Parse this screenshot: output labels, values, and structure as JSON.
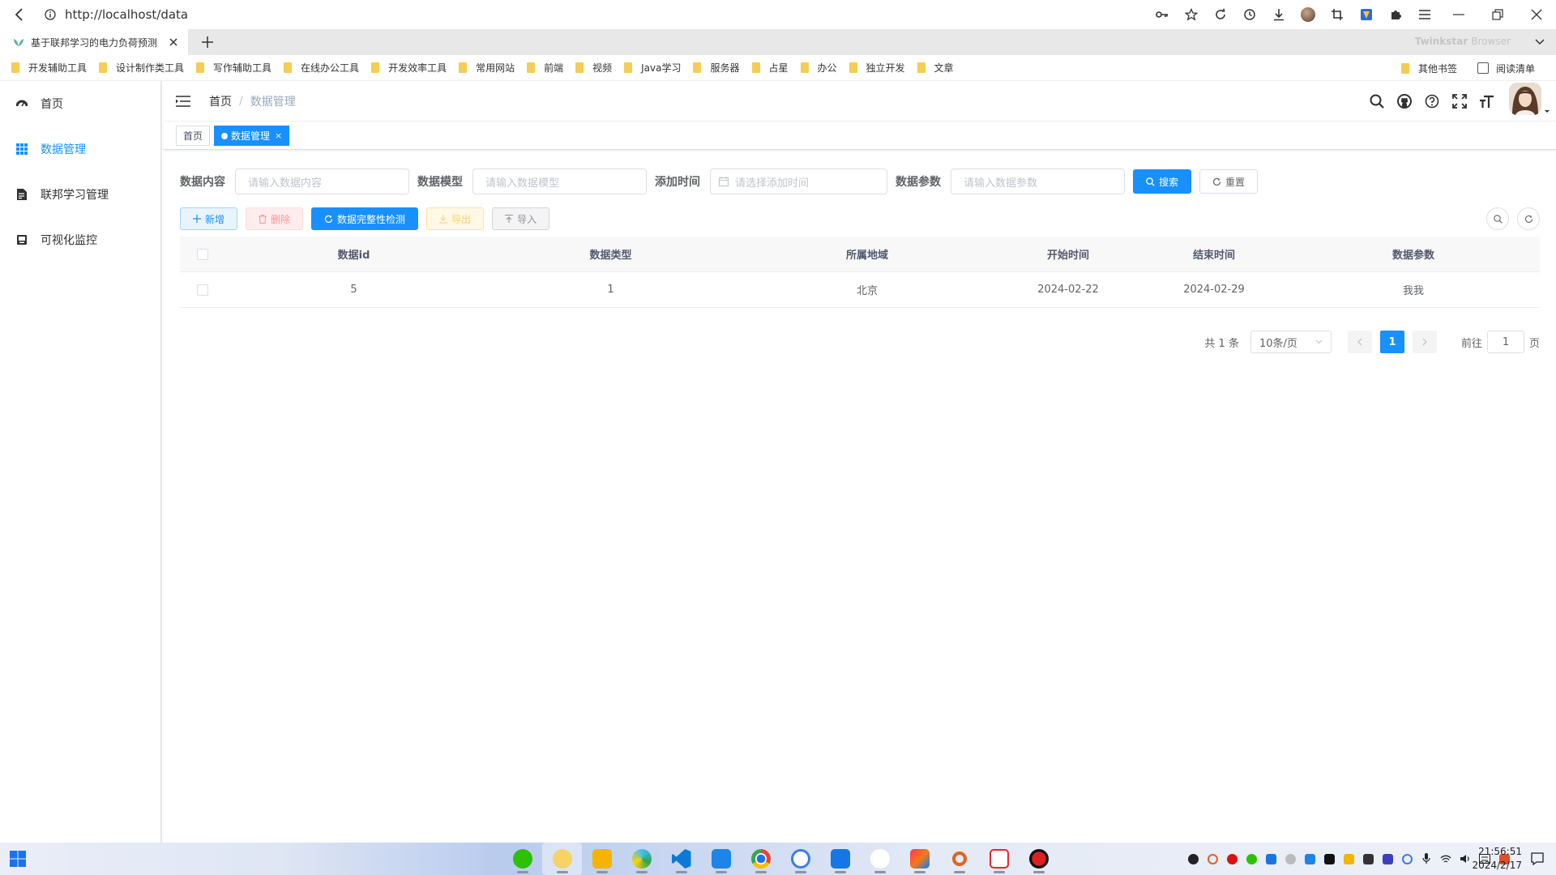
{
  "browser": {
    "url": "http://localhost/data",
    "tab_title": "基于联邦学习的电力负荷预测",
    "brand_name": "Twinkstar",
    "brand_suffix": "Browser",
    "bookmarks": [
      "开发辅助工具",
      "设计制作类工具",
      "写作辅助工具",
      "在线办公工具",
      "开发效率工具",
      "常用网站",
      "前端",
      "视频",
      "Java学习",
      "服务器",
      "占星",
      "办公",
      "独立开发",
      "文章"
    ],
    "other_bookmarks": "其他书签",
    "reading_list": "阅读清单"
  },
  "sidebar": {
    "items": [
      {
        "label": "首页",
        "icon": "dashboard-icon",
        "active": false
      },
      {
        "label": "数据管理",
        "icon": "grid-icon",
        "active": true
      },
      {
        "label": "联邦学习管理",
        "icon": "document-icon",
        "active": false
      },
      {
        "label": "可视化监控",
        "icon": "monitor-icon",
        "active": false
      }
    ]
  },
  "navbar": {
    "breadcrumb_home": "首页",
    "breadcrumb_separator": "/",
    "breadcrumb_current": "数据管理"
  },
  "tags": {
    "home": "首页",
    "current": "数据管理",
    "close": "×"
  },
  "search": {
    "content_label": "数据内容",
    "content_placeholder": "请输入数据内容",
    "model_label": "数据模型",
    "model_placeholder": "请输入数据模型",
    "time_label": "添加时间",
    "time_placeholder": "请选择添加时间",
    "param_label": "数据参数",
    "param_placeholder": "请输入数据参数",
    "search_button": "搜索",
    "reset_button": "重置"
  },
  "toolbar": {
    "add": "新增",
    "delete": "删除",
    "check": "数据完整性检测",
    "export": "导出",
    "import": "导入"
  },
  "table": {
    "columns": [
      "数据id",
      "数据类型",
      "所属地域",
      "开始时间",
      "结束时间",
      "数据参数"
    ],
    "rows": [
      [
        "5",
        "1",
        "北京",
        "2024-02-22",
        "2024-02-29",
        "我我"
      ]
    ]
  },
  "pagination": {
    "total": "共 1 条",
    "page_size": "10条/页",
    "current_page": "1",
    "goto_prefix": "前往",
    "goto_value": "1",
    "goto_suffix": "页"
  },
  "taskbar": {
    "time": "21:56:51",
    "date": "2024/2/17"
  },
  "colors": {
    "primary": "#1890ff",
    "danger": "#ff9292",
    "warning": "#ffd166"
  }
}
